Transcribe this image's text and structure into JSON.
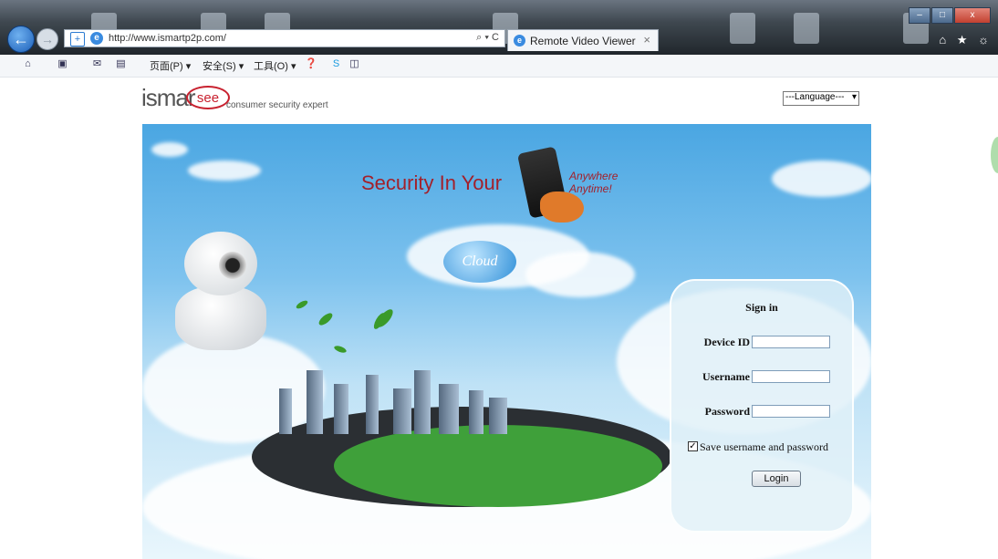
{
  "browser": {
    "url": "http://www.ismartp2p.com/",
    "tab_title": "Remote Video Viewer",
    "tab_close": "×",
    "back_glyph": "←",
    "forward_glyph": "→",
    "address_tools": "⌕ ▾ C",
    "window_buttons": [
      "–",
      "□",
      "x"
    ],
    "right_icons": "⌂ ★ ☼"
  },
  "command_bar": {
    "items": [
      "页面(P) ▾",
      "安全(S) ▾",
      "工具(O) ▾"
    ]
  },
  "page": {
    "logo_text": "ismar",
    "logo_badge": "see",
    "tagline": "consumer security expert",
    "language_select": "---Language---",
    "banner": {
      "slogan": "Security In Your",
      "slogan_right_1": "Anywhere",
      "slogan_right_2": "Anytime!",
      "cloud_badge": "Cloud"
    },
    "signin": {
      "title": "Sign in",
      "device_id_label": "Device ID",
      "username_label": "Username",
      "password_label": "Password",
      "save_label": "Save username and password",
      "save_checked": true,
      "login_button": "Login"
    }
  }
}
